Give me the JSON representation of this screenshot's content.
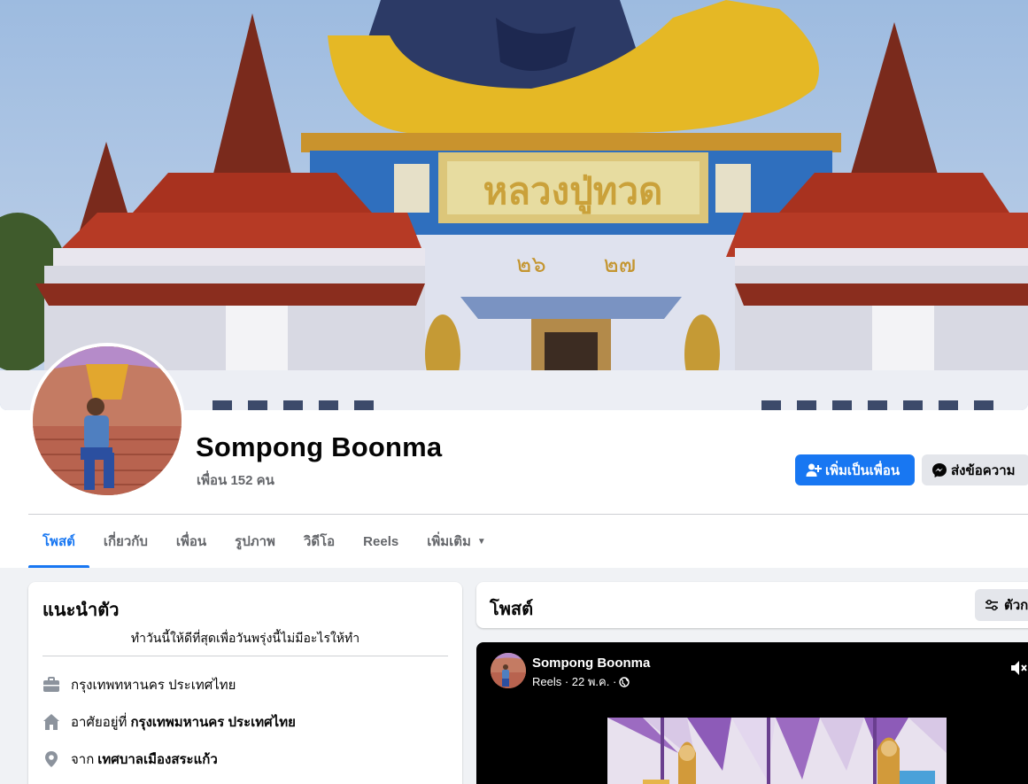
{
  "profile": {
    "name": "Sompong Boonma",
    "friends": "เพื่อน 152 คน"
  },
  "actions": {
    "add_friend": "เพิ่มเป็นเพื่อน",
    "message": "ส่งข้อความ"
  },
  "tabs": [
    {
      "label": "โพสต์"
    },
    {
      "label": "เกี่ยวกับ"
    },
    {
      "label": "เพื่อน"
    },
    {
      "label": "รูปภาพ"
    },
    {
      "label": "วิดีโอ"
    },
    {
      "label": "Reels"
    },
    {
      "label": "เพิ่มเติม"
    }
  ],
  "intro": {
    "title": "แนะนำตัว",
    "bio": "ทำวันนี้ให้ดีที่สุดเพื่อวันพรุ่งนี้ไม่มีอะไรให้ทำ",
    "work": "กรุงเทพทหานคร ประเทศไทย",
    "lives_prefix": "อาศัยอยู่ที่",
    "lives_place": "กรุงเทพมหานคร ประเทศไทย",
    "from_prefix": "จาก",
    "from_place": "เทศบาลเมืองสระแก้ว"
  },
  "posts": {
    "title": "โพสต์",
    "filter_label": "ตัวก"
  },
  "reel_post": {
    "author": "Sompong Boonma",
    "meta": "Reels · 22 พ.ค. ·"
  },
  "colors": {
    "accent": "#1877f2",
    "page_bg": "#f0f2f5",
    "secondary_text": "#65676b"
  },
  "icons": {
    "add_friend": "person-plus-icon",
    "message": "messenger-icon",
    "work": "briefcase-icon",
    "home": "house-icon",
    "location": "map-pin-icon",
    "filter": "sliders-icon",
    "privacy": "globe-icon",
    "mute": "speaker-muted-icon",
    "more_caret": "caret-down-icon"
  }
}
